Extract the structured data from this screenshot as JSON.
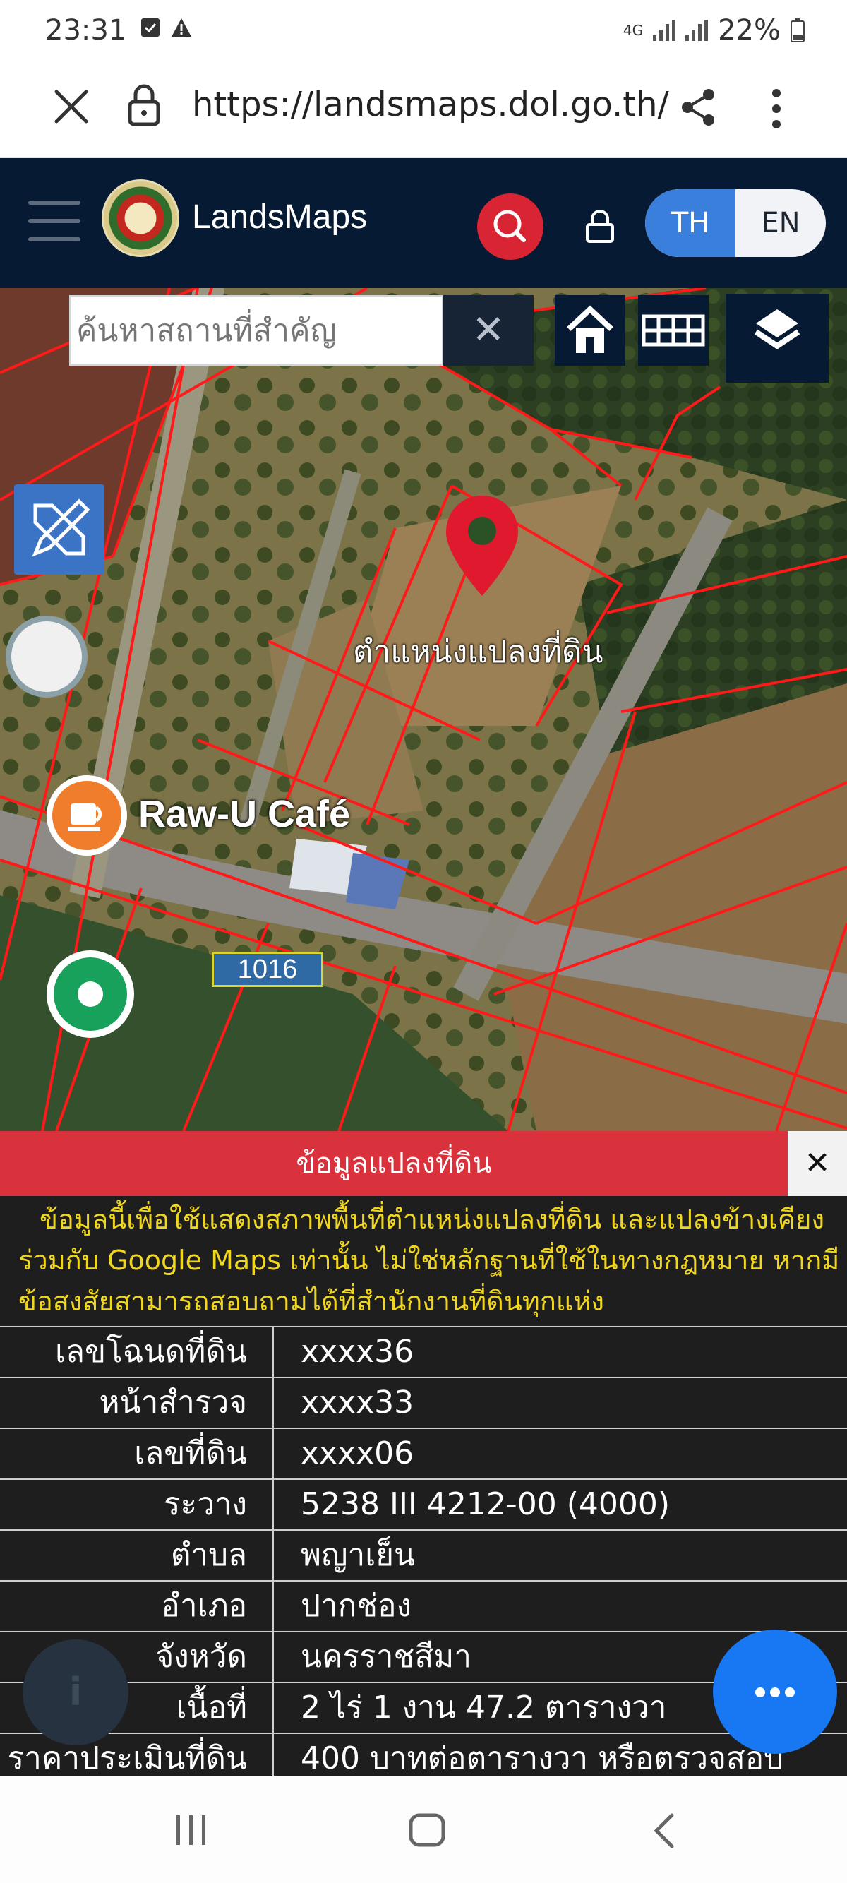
{
  "status_bar": {
    "time": "23:31",
    "network": "4G",
    "battery": "22%"
  },
  "browser": {
    "url": "https://landsmaps.dol.go.th/"
  },
  "app": {
    "name": "LandsMaps",
    "lang_th": "TH",
    "lang_en": "EN"
  },
  "map": {
    "search_placeholder": "ค้นหาสถานที่สำคัญ",
    "clear_label": "✕",
    "parcel_label": "ตำแหน่งแปลงที่ดิน",
    "place_label": "Raw-U Café",
    "road_number": "1016"
  },
  "panel": {
    "title": "ข้อมูลแปลงที่ดิน",
    "close_label": "✕",
    "notice": [
      "ข้อมูลนี้เพื่อใช้แสดงสภาพพื้นที่ตำแหน่งแปลงที่ดิน และแปลงข้างเคียง",
      "ร่วมกับ Google Maps เท่านั้น ไม่ใช่หลักฐานที่ใช้ในทางกฎหมาย หากมี",
      "ข้อสงสัยสามารถสอบถามได้ที่สำนักงานที่ดินทุกแห่ง"
    ],
    "rows": [
      {
        "label": "เลขโฉนดที่ดิน",
        "value": "xxxx36"
      },
      {
        "label": "หน้าสำรวจ",
        "value": "xxxx33"
      },
      {
        "label": "เลขที่ดิน",
        "value": "xxxx06"
      },
      {
        "label": "ระวาง",
        "value": "5238 III 4212-00 (4000)"
      },
      {
        "label": "ตำบล",
        "value": "พญาเย็น"
      },
      {
        "label": "อำเภอ",
        "value": "ปากช่อง"
      },
      {
        "label": "จังหวัด",
        "value": "นครราชสีมา"
      },
      {
        "label": "เนื้อที่",
        "value": "2 ไร่ 1 งาน 47.2 ตารางวา"
      },
      {
        "label": "ราคาประเมินที่ดิน",
        "value": "400 บาทต่อตารางวา หรือตรวจสอบ"
      }
    ],
    "info_glyph": "i"
  },
  "icons": {
    "close_tab": "close-icon",
    "lock": "lock-icon",
    "share": "share-icon",
    "menu": "more-vert-icon",
    "search": "search-icon",
    "home": "home-icon",
    "grid": "grid-icon",
    "layers": "layers-icon",
    "draw": "pencil-ruler-icon",
    "map_pin": "map-pin-icon",
    "chat_fab": "more-horizontal-icon"
  },
  "colors": {
    "header_bg": "#071a33",
    "accent_blue": "#3b7fdc",
    "panel_header": "#d9323c",
    "notice_text": "#f0d61f",
    "fab": "#1877f2",
    "parcel_lines": "#ff1a1a"
  }
}
